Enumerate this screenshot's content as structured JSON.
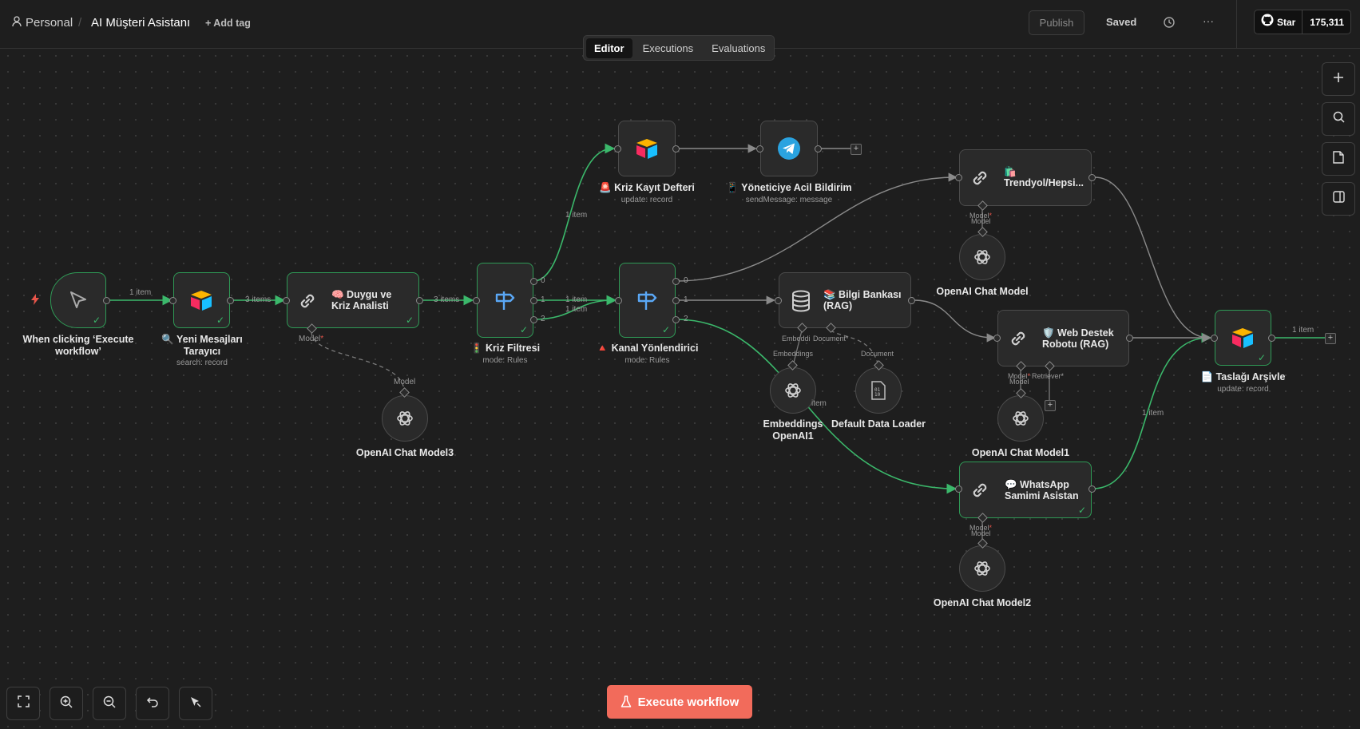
{
  "header": {
    "project": "Personal",
    "separator": "/",
    "workflow_name": "AI Müşteri Asistanı",
    "add_tag": "+ Add tag",
    "publish": "Publish",
    "saved": "Saved",
    "more": "···",
    "github_star": "Star",
    "github_count": "175,311"
  },
  "tabs": [
    "Editor",
    "Executions",
    "Evaluations"
  ],
  "nodes": {
    "trigger": {
      "label_line1": "When clicking ‘Execute",
      "label_line2": "workflow’"
    },
    "yeni": {
      "label_line1": "🔍 Yeni Mesajları",
      "label_line2": "Tarayıcı",
      "sub": "search: record"
    },
    "duygu": {
      "line1": "🧠 Duygu ve",
      "line2": "Kriz Analisti"
    },
    "kriz_filtresi": {
      "label": "🚦 Kriz Filtresi",
      "sub": "mode: Rules"
    },
    "kanal": {
      "label": "🔺 Kanal Yönlendirici",
      "sub": "mode: Rules"
    },
    "kriz_kayit": {
      "label": "🚨 Kriz Kayıt Defteri",
      "sub": "update: record"
    },
    "yonetici": {
      "label": "📱 Yöneticiye Acil Bildirim",
      "sub": "sendMessage: message"
    },
    "trendyol": {
      "line1": "🛍️",
      "line2": "Trendyol/Hepsi..."
    },
    "bilgi": {
      "line1": "📚 Bilgi Bankası",
      "line2": "(RAG)"
    },
    "web_destek": {
      "line1": "🛡️ Web Destek",
      "line2": "Robotu (RAG)"
    },
    "whatsapp": {
      "line1": "💬 WhatsApp",
      "line2": "Samimi Asistan"
    },
    "taslak": {
      "label": "📄 Taslağı Arşivle",
      "sub": "update: record"
    },
    "openai_chat_model": {
      "label": "OpenAI Chat Model"
    },
    "openai_chat_model1": {
      "label": "OpenAI Chat Model1"
    },
    "openai_chat_model2": {
      "label": "OpenAI Chat Model2"
    },
    "openai_chat_model3": {
      "label": "OpenAI Chat Model3"
    },
    "embeddings": {
      "label_line1": "Embeddings",
      "label_line2": "OpenAI1"
    },
    "data_loader": {
      "label": "Default Data Loader"
    }
  },
  "port_labels": {
    "model": "Model",
    "model_req": "Model*",
    "embedding_req": "Embeddi",
    "embeddings": "Embeddings",
    "document_req": "Document*",
    "document": "Document",
    "retriever_req": "Retriever*",
    "item": "item"
  },
  "edge_labels": {
    "one_item": "1 item",
    "three_items": "3 items",
    "out0": "0",
    "out1": "1",
    "out2": "2"
  },
  "execute_button": "Execute workflow",
  "colors": {
    "success": "#2f9a56",
    "execute": "#f26b5b",
    "rules_icon": "#5aa7f5",
    "telegram": "#2aa3e0"
  }
}
